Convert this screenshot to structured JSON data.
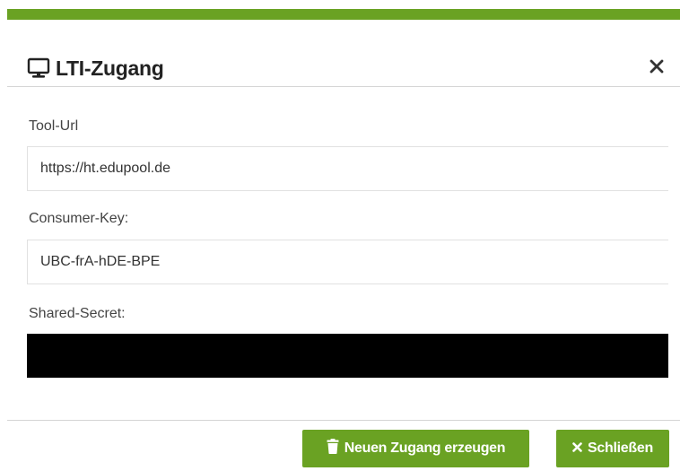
{
  "dialog": {
    "title": "LTI-Zugang",
    "close_icon": "close-icon",
    "title_icon": "monitor-icon"
  },
  "fields": {
    "tool_url": {
      "label": "Tool-Url",
      "value": "https://ht.edupool.de"
    },
    "consumer_key": {
      "label": "Consumer-Key:",
      "value": "UBC-frA-hDE-BPE"
    },
    "shared_secret": {
      "label": "Shared-Secret:",
      "value": ""
    }
  },
  "footer": {
    "new_access_label": "Neuen Zugang erzeugen",
    "new_access_icon": "trash-icon",
    "close_label": "Schließen",
    "close_icon": "x-icon"
  },
  "colors": {
    "accent": "#6aa223",
    "secret_mask": "#000000"
  }
}
